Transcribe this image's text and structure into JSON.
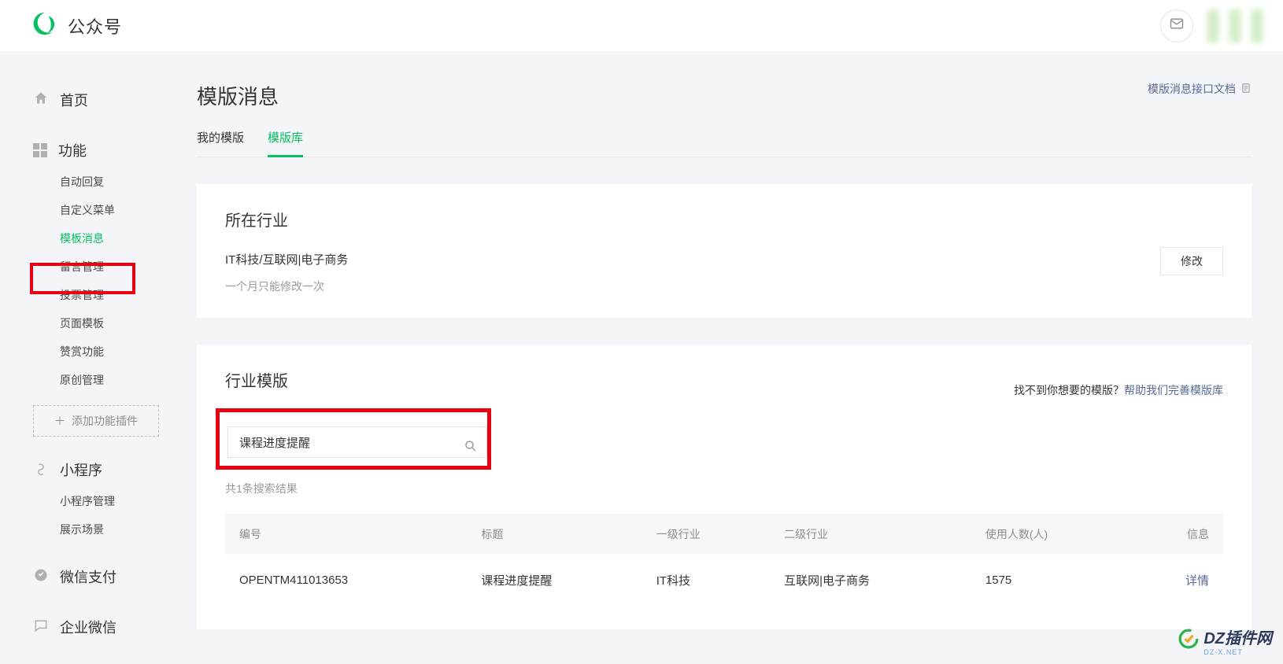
{
  "header": {
    "brand": "公众号"
  },
  "sidebar": {
    "home": "首页",
    "features_label": "功能",
    "features": [
      {
        "label": "自动回复",
        "key": "auto-reply"
      },
      {
        "label": "自定义菜单",
        "key": "custom-menu"
      },
      {
        "label": "模板消息",
        "key": "template-msg",
        "active": true
      },
      {
        "label": "留言管理",
        "key": "comments"
      },
      {
        "label": "投票管理",
        "key": "voting"
      },
      {
        "label": "页面模板",
        "key": "page-template"
      },
      {
        "label": "赞赏功能",
        "key": "rewards"
      },
      {
        "label": "原创管理",
        "key": "original"
      }
    ],
    "add_plugin": "添加功能插件",
    "miniprogram_label": "小程序",
    "miniprogram": [
      {
        "label": "小程序管理",
        "key": "mp-manage"
      },
      {
        "label": "展示场景",
        "key": "mp-scene"
      }
    ],
    "wxpay": "微信支付",
    "enterprise": "企业微信"
  },
  "page": {
    "title": "模版消息",
    "doc_link": "模版消息接口文档",
    "tabs": [
      {
        "label": "我的模版",
        "key": "mine"
      },
      {
        "label": "模版库",
        "key": "library",
        "active": true
      }
    ]
  },
  "industry_card": {
    "title": "所在行业",
    "value": "IT科技/互联网|电子商务",
    "note": "一个月只能修改一次",
    "modify": "修改"
  },
  "template_card": {
    "title": "行业模版",
    "help_prefix": "找不到你想要的模版？",
    "help_link": "帮助我们完善模版库",
    "search_value": "课程进度提醒",
    "result_count": "共1条搜索结果",
    "columns": [
      "编号",
      "标题",
      "一级行业",
      "二级行业",
      "使用人数(人)",
      "信息"
    ],
    "rows": [
      {
        "id": "OPENTM411013653",
        "title": "课程进度提醒",
        "cat1": "IT科技",
        "cat2": "互联网|电子商务",
        "users": "1575",
        "action": "详情"
      }
    ]
  },
  "watermark": {
    "text": "DZ插件网",
    "sub": "DZ-X.NET"
  }
}
